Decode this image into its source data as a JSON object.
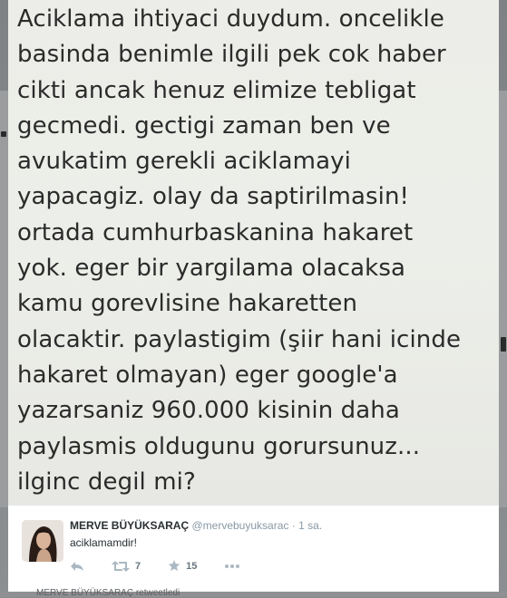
{
  "note": {
    "lines": [
      "Aciklama ihtiyaci duydum. oncelikle",
      "basinda benimle ilgili pek cok haber",
      "cikti ancak henuz elimize tebligat",
      "gecmedi. gectigi zaman ben ve",
      "avukatim gerekli aciklamayi",
      "yapacagiz. olay da saptirilmasin!",
      "ortada cumhurbaskanina hakaret",
      "yok. eger bir yargilama olacaksa",
      "kamu gorevlisine hakaretten",
      "olacaktir. paylastigim (şiir hani icinde",
      "hakaret olmayan) eger google'a",
      "yazarsaniz 960.000 kisinin daha",
      "paylasmis oldugunu gorursunuz...",
      "ilginc degil mi?"
    ]
  },
  "tweet": {
    "display_name": "MERVE BÜYÜKSARAÇ",
    "handle": "@mervebuyuksarac",
    "separator": "·",
    "time": "1 sa.",
    "text": "aciklamamdir!",
    "retweets": "7",
    "favorites": "15",
    "icons": {
      "reply": "reply-icon",
      "retweet": "retweet-icon",
      "favorite": "star-icon",
      "more": "more-icon"
    }
  },
  "footer": {
    "retweeted_by": "MERVE BÜYÜKSARAÇ retweetledi"
  },
  "colors": {
    "muted": "#8899a6",
    "text": "#292f33",
    "note_bg": "#ecede8"
  }
}
